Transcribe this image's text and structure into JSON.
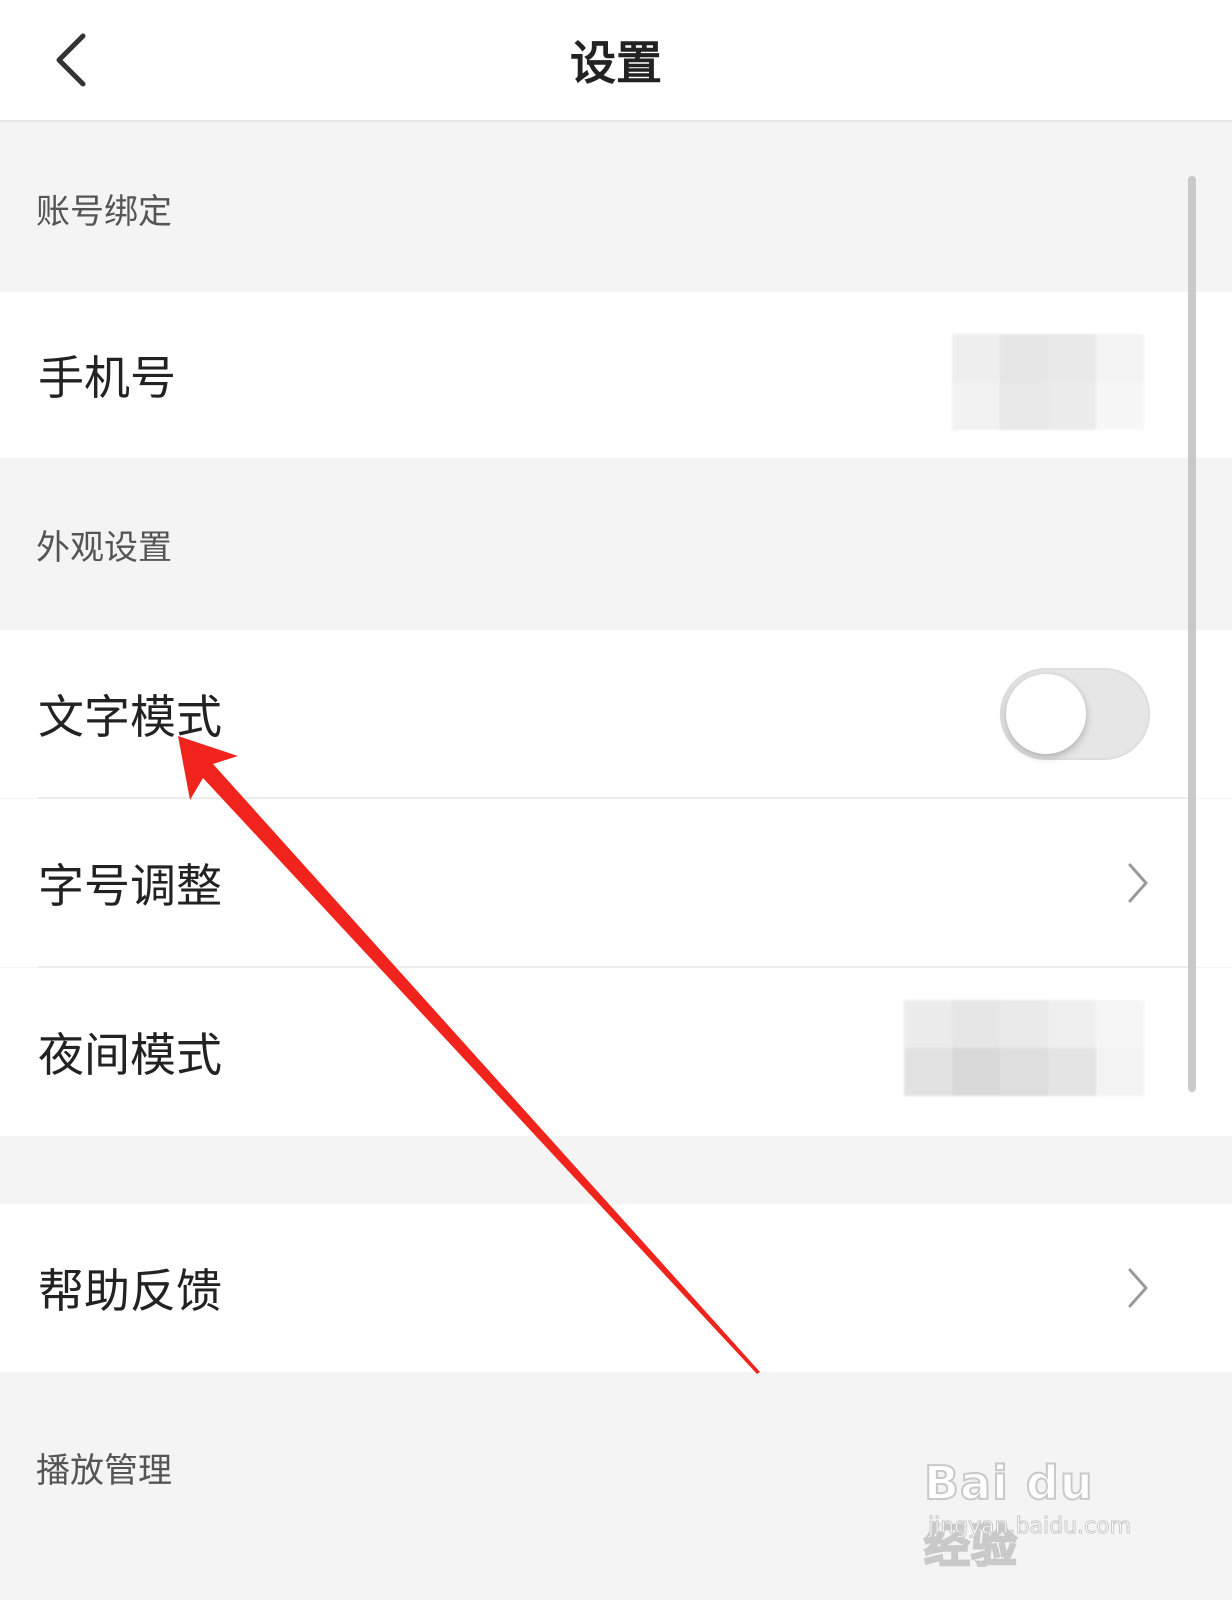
{
  "nav": {
    "title": "设置"
  },
  "sections": {
    "account": {
      "header": "账号绑定",
      "phone_label": "手机号"
    },
    "appearance": {
      "header": "外观设置",
      "text_mode_label": "文字模式",
      "text_mode_on": false,
      "font_size_label": "字号调整",
      "night_mode_label": "夜间模式"
    },
    "help": {
      "feedback_label": "帮助反馈"
    },
    "playback": {
      "header": "播放管理"
    }
  },
  "watermark": {
    "brand": "Bai du 经验",
    "url": "jingyan.baidu.com"
  },
  "colors": {
    "annotation_arrow": "#f0241c",
    "toggle_off": "#e6e6e6"
  },
  "icons": {
    "back": "chevron-left-icon",
    "row_arrow": "chevron-right-icon"
  }
}
